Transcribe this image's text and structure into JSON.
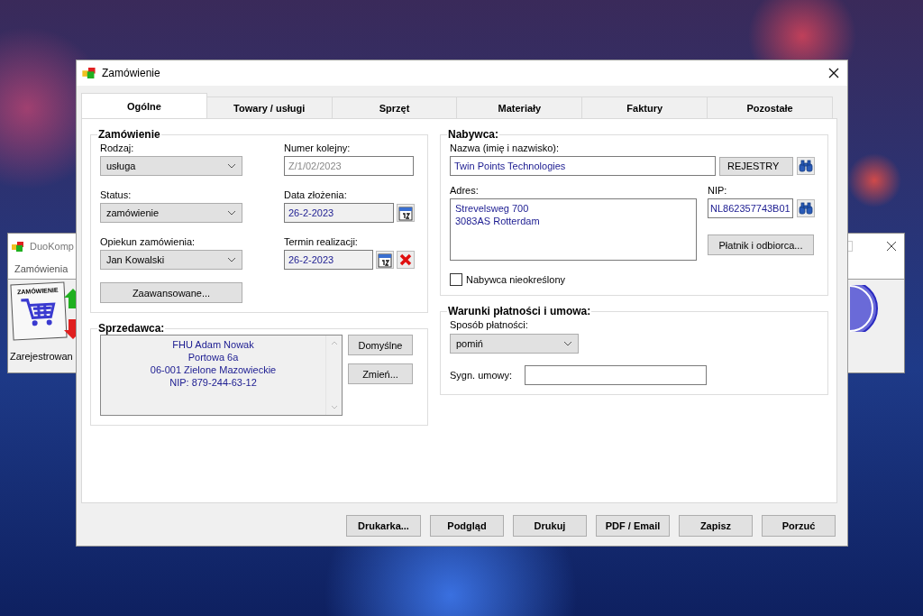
{
  "background_window": {
    "title": "DuoKomp",
    "menu": "Zamówienia",
    "icon_label": "ZAMÓWIENIE",
    "caption": "Zarejestrowan"
  },
  "dialog": {
    "title": "Zamówienie"
  },
  "tabs": [
    {
      "label": "Ogólne",
      "selected": true
    },
    {
      "label": "Towary / usługi",
      "selected": false
    },
    {
      "label": "Sprzęt",
      "selected": false
    },
    {
      "label": "Materiały",
      "selected": false
    },
    {
      "label": "Faktury",
      "selected": false
    },
    {
      "label": "Pozostałe",
      "selected": false
    }
  ],
  "order": {
    "legend": "Zamówienie",
    "fields": [
      {
        "kind": "select",
        "label": "Rodzaj:",
        "value": "usługa",
        "disabled": false
      },
      {
        "kind": "text",
        "label": "Numer kolejny:",
        "value": "Z/1/02/2023",
        "disabled": true
      },
      {
        "kind": "select",
        "label": "Status:",
        "value": "zamówienie",
        "disabled": false
      },
      {
        "kind": "date",
        "label": "Data złożenia:",
        "value": "26-2-2023",
        "disabled": false,
        "clearable": false
      },
      {
        "kind": "select",
        "label": "Opiekun zamówienia:",
        "value": "Jan Kowalski",
        "disabled": false
      },
      {
        "kind": "date",
        "label": "Termin realizacji:",
        "value": "26-2-2023",
        "disabled": false,
        "clearable": true
      }
    ],
    "advanced_button": "Zaawansowane..."
  },
  "seller": {
    "legend": "Sprzedawca:",
    "lines": [
      "FHU Adam Nowak",
      "Portowa 6a",
      "06-001 Zielone Mazowieckie",
      "NIP: 879-244-63-12"
    ],
    "buttons": [
      "Domyślne",
      "Zmień..."
    ]
  },
  "buyer": {
    "legend": "Nabywca:",
    "name_label": "Nazwa (imię i nazwisko):",
    "name": "Twin Points Technologies",
    "registry_button": "REJESTRY",
    "address_label": "Adres:",
    "address_lines": [
      "Strevelsweg 700",
      "3083AS Rotterdam"
    ],
    "nip_label": "NIP:",
    "nip": "NL862357743B01",
    "payer_button": "Płatnik i odbiorca...",
    "unspecified": {
      "label": "Nabywca nieokreślony",
      "checked": false
    }
  },
  "payment": {
    "legend": "Warunki płatności i umowa:",
    "method_label": "Sposób płatności:",
    "method": "pomiń",
    "contract_label": "Sygn. umowy:"
  },
  "buttons": [
    "Drukarka...",
    "Podgląd",
    "Drukuj",
    "PDF / Email",
    "Zapisz",
    "Porzuć"
  ]
}
